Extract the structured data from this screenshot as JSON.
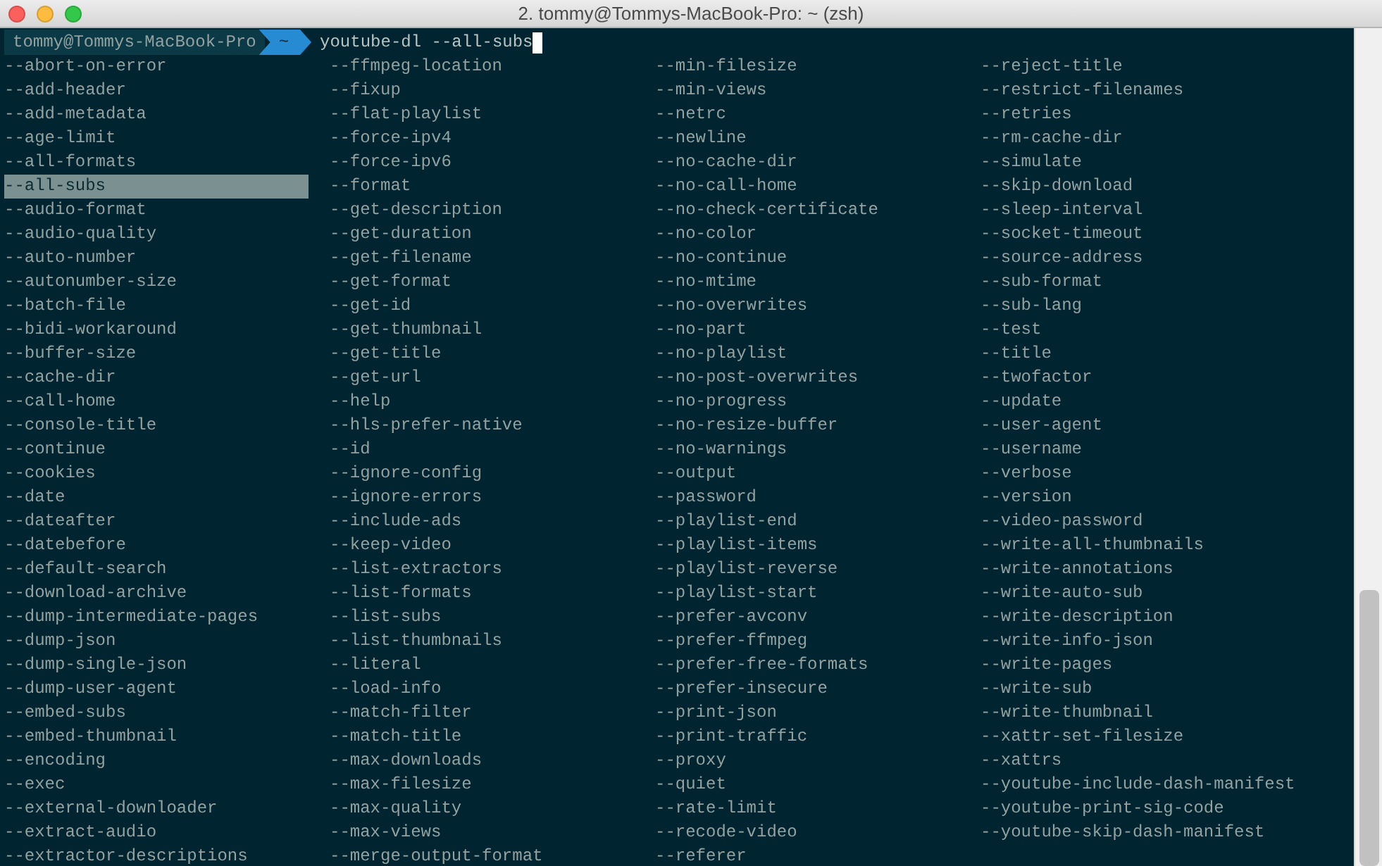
{
  "window": {
    "title": "2. tommy@Tommys-MacBook-Pro: ~ (zsh)"
  },
  "prompt": {
    "user_host": "tommy@Tommys-MacBook-Pro",
    "directory": "~",
    "command": "youtube-dl --all-subs"
  },
  "completions": [
    {
      "label": "--abort-on-error",
      "selected": false
    },
    {
      "label": "--add-header",
      "selected": false
    },
    {
      "label": "--add-metadata",
      "selected": false
    },
    {
      "label": "--age-limit",
      "selected": false
    },
    {
      "label": "--all-formats",
      "selected": false
    },
    {
      "label": "--all-subs",
      "selected": true
    },
    {
      "label": "--audio-format",
      "selected": false
    },
    {
      "label": "--audio-quality",
      "selected": false
    },
    {
      "label": "--auto-number",
      "selected": false
    },
    {
      "label": "--autonumber-size",
      "selected": false
    },
    {
      "label": "--batch-file",
      "selected": false
    },
    {
      "label": "--bidi-workaround",
      "selected": false
    },
    {
      "label": "--buffer-size",
      "selected": false
    },
    {
      "label": "--cache-dir",
      "selected": false
    },
    {
      "label": "--call-home",
      "selected": false
    },
    {
      "label": "--console-title",
      "selected": false
    },
    {
      "label": "--continue",
      "selected": false
    },
    {
      "label": "--cookies",
      "selected": false
    },
    {
      "label": "--date",
      "selected": false
    },
    {
      "label": "--dateafter",
      "selected": false
    },
    {
      "label": "--datebefore",
      "selected": false
    },
    {
      "label": "--default-search",
      "selected": false
    },
    {
      "label": "--download-archive",
      "selected": false
    },
    {
      "label": "--dump-intermediate-pages",
      "selected": false
    },
    {
      "label": "--dump-json",
      "selected": false
    },
    {
      "label": "--dump-single-json",
      "selected": false
    },
    {
      "label": "--dump-user-agent",
      "selected": false
    },
    {
      "label": "--embed-subs",
      "selected": false
    },
    {
      "label": "--embed-thumbnail",
      "selected": false
    },
    {
      "label": "--encoding",
      "selected": false
    },
    {
      "label": "--exec",
      "selected": false
    },
    {
      "label": "--external-downloader",
      "selected": false
    },
    {
      "label": "--extract-audio",
      "selected": false
    },
    {
      "label": "--extractor-descriptions",
      "selected": false
    },
    {
      "label": "--ffmpeg-location",
      "selected": false
    },
    {
      "label": "--fixup",
      "selected": false
    },
    {
      "label": "--flat-playlist",
      "selected": false
    },
    {
      "label": "--force-ipv4",
      "selected": false
    },
    {
      "label": "--force-ipv6",
      "selected": false
    },
    {
      "label": "--format",
      "selected": false
    },
    {
      "label": "--get-description",
      "selected": false
    },
    {
      "label": "--get-duration",
      "selected": false
    },
    {
      "label": "--get-filename",
      "selected": false
    },
    {
      "label": "--get-format",
      "selected": false
    },
    {
      "label": "--get-id",
      "selected": false
    },
    {
      "label": "--get-thumbnail",
      "selected": false
    },
    {
      "label": "--get-title",
      "selected": false
    },
    {
      "label": "--get-url",
      "selected": false
    },
    {
      "label": "--help",
      "selected": false
    },
    {
      "label": "--hls-prefer-native",
      "selected": false
    },
    {
      "label": "--id",
      "selected": false
    },
    {
      "label": "--ignore-config",
      "selected": false
    },
    {
      "label": "--ignore-errors",
      "selected": false
    },
    {
      "label": "--include-ads",
      "selected": false
    },
    {
      "label": "--keep-video",
      "selected": false
    },
    {
      "label": "--list-extractors",
      "selected": false
    },
    {
      "label": "--list-formats",
      "selected": false
    },
    {
      "label": "--list-subs",
      "selected": false
    },
    {
      "label": "--list-thumbnails",
      "selected": false
    },
    {
      "label": "--literal",
      "selected": false
    },
    {
      "label": "--load-info",
      "selected": false
    },
    {
      "label": "--match-filter",
      "selected": false
    },
    {
      "label": "--match-title",
      "selected": false
    },
    {
      "label": "--max-downloads",
      "selected": false
    },
    {
      "label": "--max-filesize",
      "selected": false
    },
    {
      "label": "--max-quality",
      "selected": false
    },
    {
      "label": "--max-views",
      "selected": false
    },
    {
      "label": "--merge-output-format",
      "selected": false
    },
    {
      "label": "--min-filesize",
      "selected": false
    },
    {
      "label": "--min-views",
      "selected": false
    },
    {
      "label": "--netrc",
      "selected": false
    },
    {
      "label": "--newline",
      "selected": false
    },
    {
      "label": "--no-cache-dir",
      "selected": false
    },
    {
      "label": "--no-call-home",
      "selected": false
    },
    {
      "label": "--no-check-certificate",
      "selected": false
    },
    {
      "label": "--no-color",
      "selected": false
    },
    {
      "label": "--no-continue",
      "selected": false
    },
    {
      "label": "--no-mtime",
      "selected": false
    },
    {
      "label": "--no-overwrites",
      "selected": false
    },
    {
      "label": "--no-part",
      "selected": false
    },
    {
      "label": "--no-playlist",
      "selected": false
    },
    {
      "label": "--no-post-overwrites",
      "selected": false
    },
    {
      "label": "--no-progress",
      "selected": false
    },
    {
      "label": "--no-resize-buffer",
      "selected": false
    },
    {
      "label": "--no-warnings",
      "selected": false
    },
    {
      "label": "--output",
      "selected": false
    },
    {
      "label": "--password",
      "selected": false
    },
    {
      "label": "--playlist-end",
      "selected": false
    },
    {
      "label": "--playlist-items",
      "selected": false
    },
    {
      "label": "--playlist-reverse",
      "selected": false
    },
    {
      "label": "--playlist-start",
      "selected": false
    },
    {
      "label": "--prefer-avconv",
      "selected": false
    },
    {
      "label": "--prefer-ffmpeg",
      "selected": false
    },
    {
      "label": "--prefer-free-formats",
      "selected": false
    },
    {
      "label": "--prefer-insecure",
      "selected": false
    },
    {
      "label": "--print-json",
      "selected": false
    },
    {
      "label": "--print-traffic",
      "selected": false
    },
    {
      "label": "--proxy",
      "selected": false
    },
    {
      "label": "--quiet",
      "selected": false
    },
    {
      "label": "--rate-limit",
      "selected": false
    },
    {
      "label": "--recode-video",
      "selected": false
    },
    {
      "label": "--referer",
      "selected": false
    },
    {
      "label": "--reject-title",
      "selected": false
    },
    {
      "label": "--restrict-filenames",
      "selected": false
    },
    {
      "label": "--retries",
      "selected": false
    },
    {
      "label": "--rm-cache-dir",
      "selected": false
    },
    {
      "label": "--simulate",
      "selected": false
    },
    {
      "label": "--skip-download",
      "selected": false
    },
    {
      "label": "--sleep-interval",
      "selected": false
    },
    {
      "label": "--socket-timeout",
      "selected": false
    },
    {
      "label": "--source-address",
      "selected": false
    },
    {
      "label": "--sub-format",
      "selected": false
    },
    {
      "label": "--sub-lang",
      "selected": false
    },
    {
      "label": "--test",
      "selected": false
    },
    {
      "label": "--title",
      "selected": false
    },
    {
      "label": "--twofactor",
      "selected": false
    },
    {
      "label": "--update",
      "selected": false
    },
    {
      "label": "--user-agent",
      "selected": false
    },
    {
      "label": "--username",
      "selected": false
    },
    {
      "label": "--verbose",
      "selected": false
    },
    {
      "label": "--version",
      "selected": false
    },
    {
      "label": "--video-password",
      "selected": false
    },
    {
      "label": "--write-all-thumbnails",
      "selected": false
    },
    {
      "label": "--write-annotations",
      "selected": false
    },
    {
      "label": "--write-auto-sub",
      "selected": false
    },
    {
      "label": "--write-description",
      "selected": false
    },
    {
      "label": "--write-info-json",
      "selected": false
    },
    {
      "label": "--write-pages",
      "selected": false
    },
    {
      "label": "--write-sub",
      "selected": false
    },
    {
      "label": "--write-thumbnail",
      "selected": false
    },
    {
      "label": "--xattr-set-filesize",
      "selected": false
    },
    {
      "label": "--xattrs",
      "selected": false
    },
    {
      "label": "--youtube-include-dash-manifest",
      "selected": false
    },
    {
      "label": "--youtube-print-sig-code",
      "selected": false
    },
    {
      "label": "--youtube-skip-dash-manifest",
      "selected": false
    }
  ]
}
